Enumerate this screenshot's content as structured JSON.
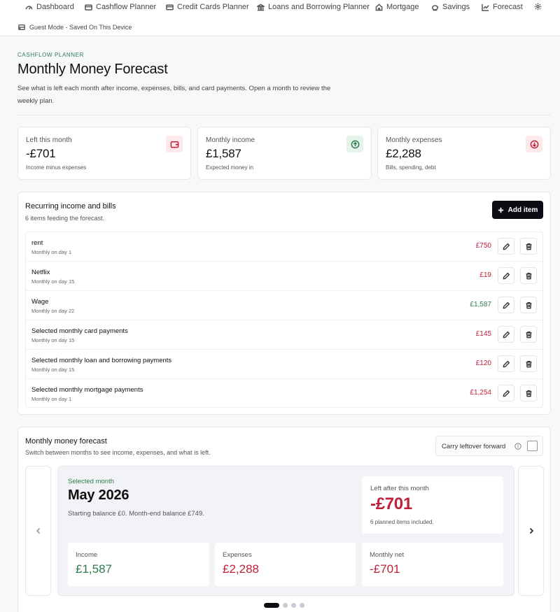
{
  "nav": {
    "items": [
      {
        "label": "Dashboard",
        "icon": "gauge-icon"
      },
      {
        "label": "Cashflow Planner",
        "icon": "wallet-icon"
      },
      {
        "label": "Credit Cards Planner",
        "icon": "credit-card-icon"
      },
      {
        "label": "Loans and Borrowing Planner",
        "icon": "bank-icon"
      },
      {
        "label": "Mortgage",
        "icon": "home-icon"
      },
      {
        "label": "Savings",
        "icon": "piggy-bank-icon"
      },
      {
        "label": "Forecast",
        "icon": "line-chart-icon"
      }
    ],
    "settings_icon": "gear-icon",
    "guest_mode": "Guest Mode - Saved On This Device"
  },
  "header": {
    "eyebrow": "CASHFLOW PLANNER",
    "title": "Monthly Money Forecast",
    "subtitle": "See what is left each month after income, expenses, bills, and card payments. Open a month to review the weekly plan."
  },
  "stats": [
    {
      "label": "Left this month",
      "value": "-£701",
      "sub": "Income minus expenses",
      "icon": "wallet-icon",
      "color": "#c0203a"
    },
    {
      "label": "Monthly income",
      "value": "£1,587",
      "sub": "Expected money in",
      "icon": "arrow-up-circle-icon",
      "color": "#2f7a4f"
    },
    {
      "label": "Monthly expenses",
      "value": "£2,288",
      "sub": "Bills, spending, debt",
      "icon": "arrow-down-circle-icon",
      "color": "#c0203a"
    }
  ],
  "recurring": {
    "title": "Recurring income and bills",
    "subtitle": "6 items feeding the forecast.",
    "add_label": "Add item",
    "items": [
      {
        "name": "rent",
        "schedule": "Monthly on day 1",
        "amount": "£750",
        "kind": "expense"
      },
      {
        "name": "Netflix",
        "schedule": "Monthly on day 15",
        "amount": "£19",
        "kind": "expense"
      },
      {
        "name": "Wage",
        "schedule": "Monthly on day 22",
        "amount": "£1,587",
        "kind": "income"
      },
      {
        "name": "Selected monthly card payments",
        "schedule": "Monthly on day 15",
        "amount": "£145",
        "kind": "expense"
      },
      {
        "name": "Selected monthly loan and borrowing payments",
        "schedule": "Monthly on day 15",
        "amount": "£120",
        "kind": "expense"
      },
      {
        "name": "Selected monthly mortgage payments",
        "schedule": "Monthly on day 1",
        "amount": "£1,254",
        "kind": "expense"
      }
    ]
  },
  "forecast": {
    "title": "Monthly money forecast",
    "subtitle": "Switch between months to see income, expenses, and what is left.",
    "carry_label": "Carry leftover forward",
    "carry_checked": false,
    "selected_label": "Selected month",
    "month": "May 2026",
    "month_sub": "Starting balance £0. Month-end balance £749.",
    "left_label": "Left after this month",
    "left_value": "-£701",
    "left_sub": "6 planned items included.",
    "income_label": "Income",
    "income_value": "£1,587",
    "expenses_label": "Expenses",
    "expenses_value": "£2,288",
    "net_label": "Monthly net",
    "net_value": "-£701",
    "page_count": 4,
    "current_page": 1
  },
  "colors": {
    "negative": "#c0203a",
    "positive": "#2f7a4f",
    "primary_button": "#0b0d12"
  }
}
